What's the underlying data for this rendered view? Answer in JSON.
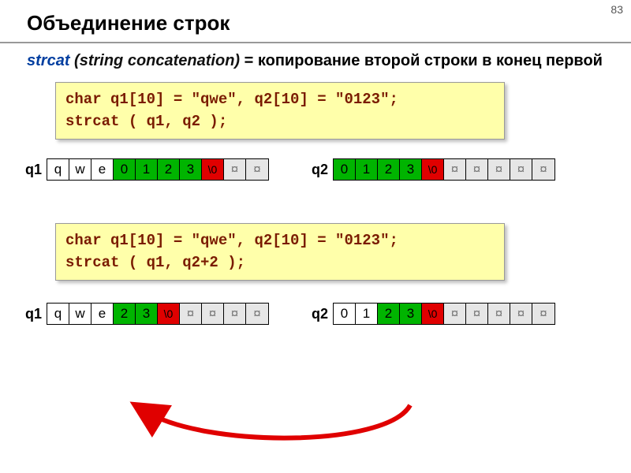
{
  "slide_number": "83",
  "title": "Объединение строк",
  "intro": {
    "func": "strcat",
    "open": "(",
    "expansion": "string concatenation",
    "close": ")",
    "rest": " = копирование второй строки в конец первой"
  },
  "code1": {
    "line1": "char q1[10] = \"qwe\", q2[10] = \"0123\";",
    "line2": "strcat ( q1, q2 );"
  },
  "code2": {
    "line1": "char q1[10] = \"qwe\", q2[10] = \"0123\";",
    "line2": "strcat ( q1, q2+2 );"
  },
  "labels": {
    "q1": "q1",
    "q2": "q2"
  },
  "row1": {
    "q1": [
      {
        "v": "q",
        "c": "white"
      },
      {
        "v": "w",
        "c": "white"
      },
      {
        "v": "e",
        "c": "white"
      },
      {
        "v": "0",
        "c": "green"
      },
      {
        "v": "1",
        "c": "green"
      },
      {
        "v": "2",
        "c": "green"
      },
      {
        "v": "3",
        "c": "green"
      },
      {
        "v": "\\0",
        "c": "red",
        "small": true
      },
      {
        "v": "¤",
        "c": "gray"
      },
      {
        "v": "¤",
        "c": "gray"
      }
    ],
    "q2": [
      {
        "v": "0",
        "c": "green"
      },
      {
        "v": "1",
        "c": "green"
      },
      {
        "v": "2",
        "c": "green"
      },
      {
        "v": "3",
        "c": "green"
      },
      {
        "v": "\\0",
        "c": "red",
        "small": true
      },
      {
        "v": "¤",
        "c": "gray"
      },
      {
        "v": "¤",
        "c": "gray"
      },
      {
        "v": "¤",
        "c": "gray"
      },
      {
        "v": "¤",
        "c": "gray"
      },
      {
        "v": "¤",
        "c": "gray"
      }
    ]
  },
  "row2": {
    "q1": [
      {
        "v": "q",
        "c": "white"
      },
      {
        "v": "w",
        "c": "white"
      },
      {
        "v": "e",
        "c": "white"
      },
      {
        "v": "2",
        "c": "green"
      },
      {
        "v": "3",
        "c": "green"
      },
      {
        "v": "\\0",
        "c": "red",
        "small": true
      },
      {
        "v": "¤",
        "c": "gray"
      },
      {
        "v": "¤",
        "c": "gray"
      },
      {
        "v": "¤",
        "c": "gray"
      },
      {
        "v": "¤",
        "c": "gray"
      }
    ],
    "q2": [
      {
        "v": "0",
        "c": "white"
      },
      {
        "v": "1",
        "c": "white"
      },
      {
        "v": "2",
        "c": "green"
      },
      {
        "v": "3",
        "c": "green"
      },
      {
        "v": "\\0",
        "c": "red",
        "small": true
      },
      {
        "v": "¤",
        "c": "gray"
      },
      {
        "v": "¤",
        "c": "gray"
      },
      {
        "v": "¤",
        "c": "gray"
      },
      {
        "v": "¤",
        "c": "gray"
      },
      {
        "v": "¤",
        "c": "gray"
      }
    ]
  }
}
